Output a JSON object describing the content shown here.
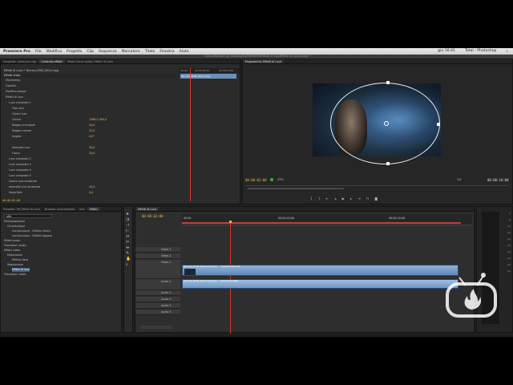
{
  "menubar": {
    "app": "Premiere Pro",
    "items": [
      "File",
      "Modifica",
      "Progetto",
      "Clip",
      "Sequenza",
      "Marcatore",
      "Titolo",
      "Finestra",
      "Aiuto"
    ],
    "status": [
      "gio 16:41",
      "Total - Photoshop"
    ]
  },
  "path": "~/Users/Rendering/_Shadow/Ita/PREMIERE/Effetti di luce/Effetti di Luce.prproj *",
  "effect_controls": {
    "tabs": [
      "Sorgente: (nessuna clip)",
      "Controllo effetti",
      "Mixer tracce audio: Effetti di Luce"
    ],
    "header": "Effetti di Luce * Tecnica_PDM_0012.mpg",
    "mini_tc": [
      "00:00",
      "00:00:05:00",
      "00:00:10:00"
    ],
    "clip_name": "Tecnica_PDM_0012.mpg",
    "section": "Effetti video",
    "rows": [
      {
        "label": "Movimento",
        "value": ""
      },
      {
        "label": "Opacità",
        "value": ""
      },
      {
        "label": "Modifica tempo",
        "value": ""
      },
      {
        "label": "Effetti di luce",
        "value": ""
      },
      {
        "label": "Luce comprata 1",
        "value": ""
      },
      {
        "label": "Tipo luce",
        "value": ""
      },
      {
        "label": "Colore luce",
        "value": ""
      },
      {
        "label": "Centro",
        "value": "1386,0   384,0"
      },
      {
        "label": "Raggio principale",
        "value": "20,0"
      },
      {
        "label": "Raggio minore",
        "value": "22,0"
      },
      {
        "label": "Angolo",
        "value": "0,0°"
      },
      {
        "label": "",
        "value": ""
      },
      {
        "label": "Intensità luce",
        "value": "30,0"
      },
      {
        "label": "Fuoco",
        "value": "20,0"
      },
      {
        "label": "Luce comprata 2",
        "value": ""
      },
      {
        "label": "Luce comprata 3",
        "value": ""
      },
      {
        "label": "Luce comprata 4",
        "value": ""
      },
      {
        "label": "Luce comprata 5",
        "value": ""
      },
      {
        "label": "Colore luce ambiente",
        "value": ""
      },
      {
        "label": "Intensità luce ambiente",
        "value": "20,0"
      },
      {
        "label": "Superficie",
        "value": "0,0"
      }
    ],
    "timecode": "00:00:02:00"
  },
  "program": {
    "title": "Programma: Effetti di Luce",
    "timecode": "00:00:02:00",
    "fit": "25%",
    "quality": "1/2",
    "duration": "00:00:10:00"
  },
  "project": {
    "tabs": [
      "Progetto: Eff_Effetti di Luce",
      "Browser multimediale",
      "Info",
      "Effetti"
    ],
    "search_value": "effe",
    "tree": [
      "Preimpostazioni",
      "Convoluzione",
      "Convoluzione - Effetto rilievo",
      "Convoluzione - Effetto leggero",
      "Effetti audio",
      "Transizioni audio",
      "Effetti video",
      "Distorsione",
      "Effetto sfera",
      "Regolazione",
      "Effetti di luce",
      "Transizioni video"
    ]
  },
  "timeline": {
    "tab": "Effetti di Luce",
    "timecode": "00:00:02:00",
    "ruler": [
      "00:00",
      "00:00:05:00",
      "00:00:10:00"
    ],
    "tracks": [
      "Video 3",
      "Video 2",
      "Video 1",
      "Audio 1",
      "Audio 2",
      "Audio 3",
      "Audio 4",
      "Audio 5"
    ],
    "clips": {
      "v1a": "Tecnica_PDM_0012.mpg [V]",
      "v1b": "Opacità:Opacità",
      "a1a": "Tecnica_PDM_0012.mpg [A]",
      "a1b": "Volume:Livello"
    }
  },
  "meters": [
    "0",
    "-6",
    "-12",
    "-18",
    "-24",
    "-30",
    "-36",
    "-42",
    "-48",
    "-54"
  ]
}
